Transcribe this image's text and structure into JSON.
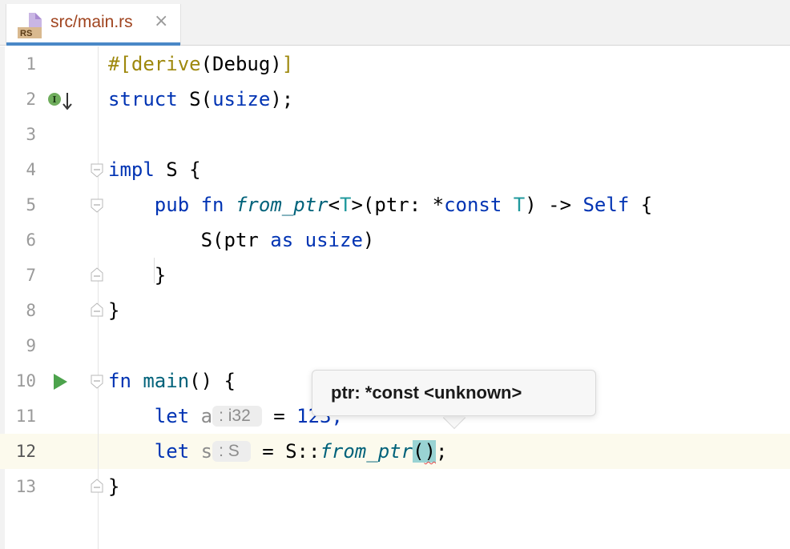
{
  "tab": {
    "filename": "src/main.rs",
    "icon_label": "RS",
    "close_glyph": "×"
  },
  "gutter": {
    "line_numbers": [
      "1",
      "2",
      "3",
      "4",
      "5",
      "6",
      "7",
      "8",
      "9",
      "10",
      "11",
      "12",
      "13"
    ],
    "current_line": "12"
  },
  "lines": {
    "l1": {
      "hash": "#[",
      "attr": "derive",
      "rest": "(Debug)",
      "close": "]"
    },
    "l2": {
      "kw": "struct",
      "name": " S(",
      "type": "usize",
      "end": ");"
    },
    "l4": {
      "kw": "impl",
      "rest": " S {"
    },
    "l5": {
      "indent": "    ",
      "kw_pub": "pub",
      "sp1": " ",
      "kw_fn": "fn",
      "sp2": " ",
      "fname": "from_ptr",
      "lt": "<",
      "tp": "T",
      "gt": ">(ptr: *",
      "kw_const": "const",
      "sp3": " ",
      "tp2": "T",
      "arrow": ") -> ",
      "self": "Self",
      "brace": " {"
    },
    "l6": {
      "indent": "        ",
      "pre": "S(ptr ",
      "kw_as": "as",
      "sp": " ",
      "type": "usize",
      "end": ")"
    },
    "l7": {
      "text": "    }"
    },
    "l8": {
      "text": "}"
    },
    "l10": {
      "kw": "fn",
      "sp": " ",
      "fname": "main",
      "rest": "() {"
    },
    "l11": {
      "indent": "    ",
      "kw": "let",
      "var": " a",
      "hint": ": i32",
      "eq": " = ",
      "num": "123;"
    },
    "l12": {
      "indent": "    ",
      "kw": "let",
      "var": " s",
      "hint": ": S",
      "eq": " = S::",
      "fname": "from_ptr",
      "paren_open": "(",
      "paren_close": ")",
      "semi": ";"
    },
    "l13": {
      "text": "}"
    }
  },
  "tooltip": {
    "text": "ptr: *const <unknown>"
  },
  "icons": {
    "run": "run-gutter-icon",
    "implemented": "implemented-trait-icon",
    "fold": "fold-marker-icon"
  },
  "colors": {
    "keyword": "#0033b3",
    "attribute": "#9e880d",
    "function": "#00627a",
    "type_param": "#20999d",
    "tab_accent": "#4a88c7",
    "current_line": "#fcfaed"
  }
}
